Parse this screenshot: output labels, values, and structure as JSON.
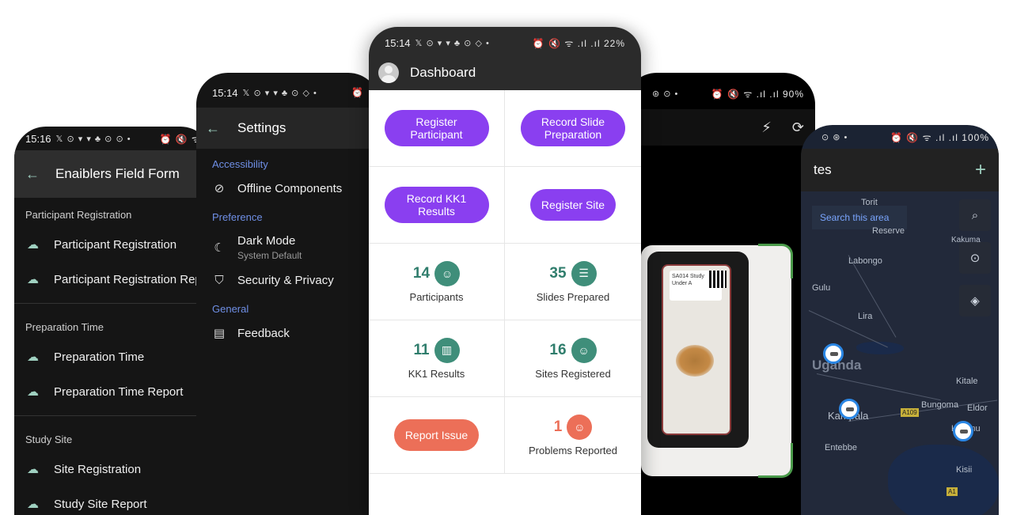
{
  "phone_form": {
    "time": "15:16",
    "status_icons": "𝕏 ⊙ ▾ ▾ ♣ ⊙ ⊙ •",
    "status_right": "⏰ 🔇 ᯤ",
    "title": "Enaiblers Field Form",
    "sections": [
      {
        "header": "Participant Registration",
        "items": [
          "Participant Registration",
          "Participant Registration Rep"
        ]
      },
      {
        "header": "Preparation Time",
        "items": [
          "Preparation Time",
          "Preparation Time Report"
        ]
      },
      {
        "header": "Study Site",
        "items": [
          "Site Registration",
          "Study Site Report"
        ]
      }
    ]
  },
  "phone_settings": {
    "time": "15:14",
    "status_icons": "𝕏 ⊙ ▾ ▾ ♣ ⊙ ◇ •",
    "status_right": "⏰",
    "title": "Settings",
    "accessibility_header": "Accessibility",
    "offline_label": "Offline Components",
    "preference_header": "Preference",
    "dark_mode_label": "Dark Mode",
    "dark_mode_value": "System Default",
    "security_label": "Security & Privacy",
    "general_header": "General",
    "feedback_label": "Feedback"
  },
  "phone_dashboard": {
    "time": "15:14",
    "status_icons": "𝕏 ⊙ ▾ ▾ ♣ ⊙ ◇ •",
    "status_right": "⏰ 🔇 ᯤ .ıl .ıl 22%",
    "title": "Dashboard",
    "register_participant": "Register Participant",
    "record_slide": "Record Slide Preparation",
    "record_kk1": "Record KK1 Results",
    "register_site": "Register Site",
    "participants_count": "14",
    "participants_label": "Participants",
    "slides_count": "35",
    "slides_label": "Slides Prepared",
    "kk1_count": "11",
    "kk1_label": "KK1 Results",
    "sites_count": "16",
    "sites_label": "Sites Registered",
    "report_issue": "Report Issue",
    "problems_count": "1",
    "problems_label": "Problems Reported"
  },
  "phone_camera": {
    "status_icons": "⊛ ⊙ •",
    "status_right": "⏰ 🔇 ᯤ .ıl .ıl 90%",
    "label_text": "SA014 Study Under A"
  },
  "phone_map": {
    "status_icons": "⊙ ⊛ •",
    "status_right": "⏰ 🔇 ᯤ .ıl .ıl 100%",
    "title_fragment": "tes",
    "search_area": "Search this area",
    "places": {
      "tarit": "Torit",
      "reserve": "Reserve",
      "kakuma": "Kakuma",
      "labongo": "Labongo",
      "gulu": "Gulu",
      "lira": "Lira",
      "uganda": "Uganda",
      "kitale": "Kitale",
      "kampala": "Kampala",
      "bungoma": "Bungoma",
      "eldoret": "Eldor",
      "entebbe": "Entebbe",
      "kisumu": "Kisumu",
      "kisii": "Kisii",
      "a109": "A109",
      "a1": "A1"
    }
  }
}
